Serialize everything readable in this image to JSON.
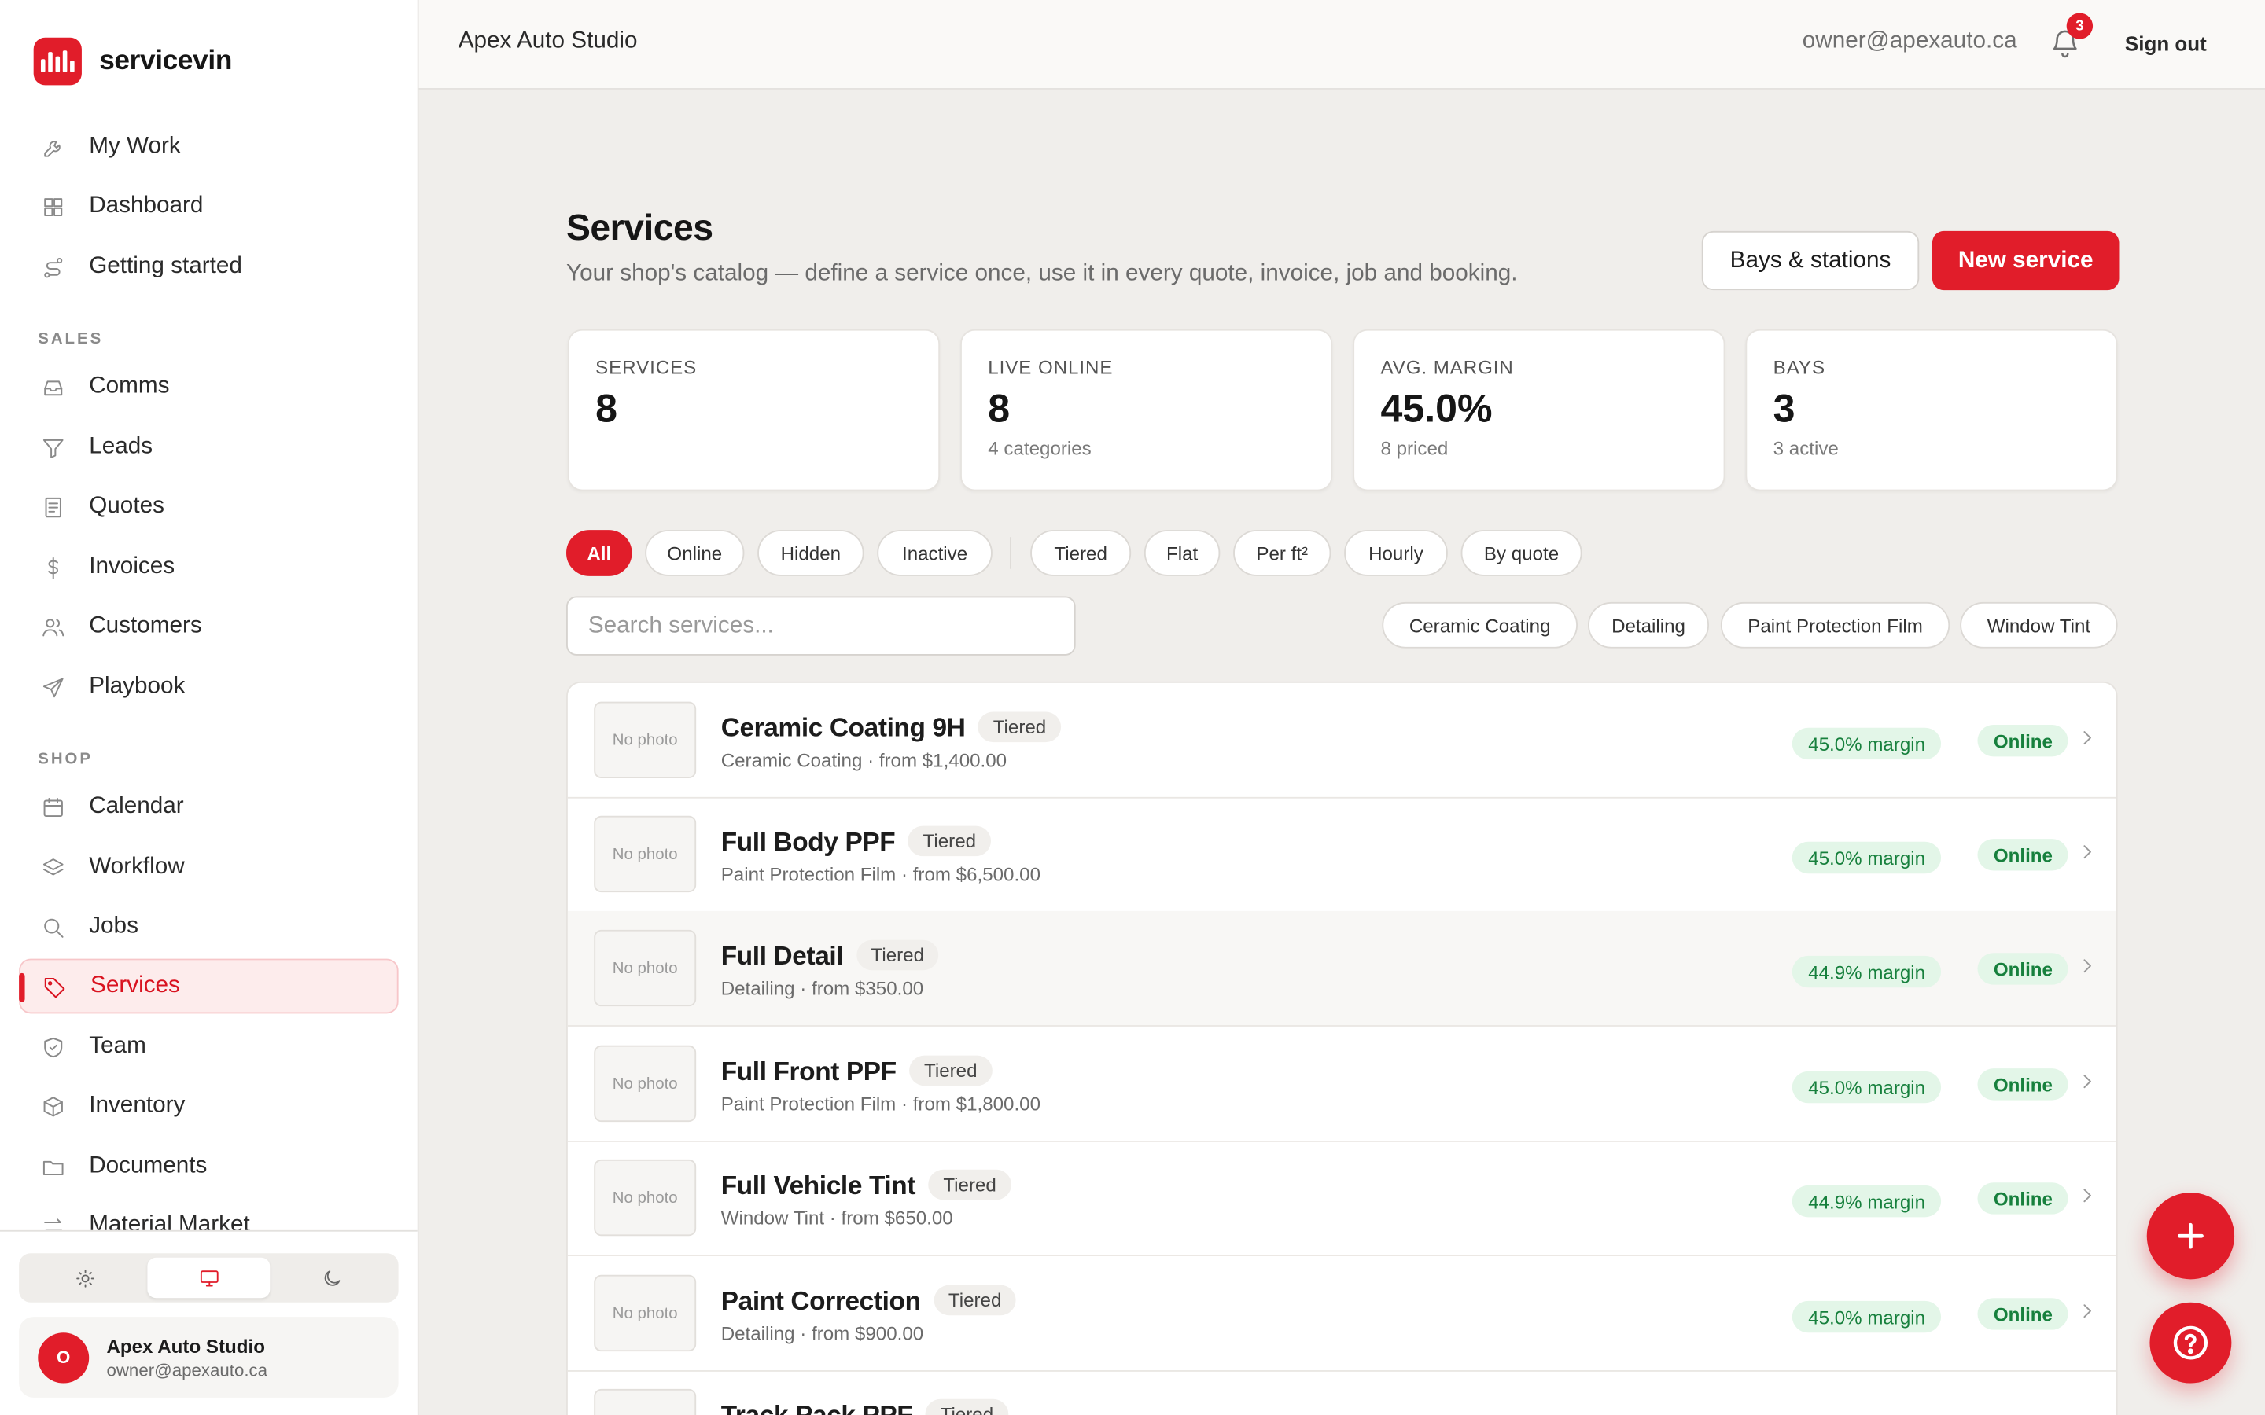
{
  "brand": {
    "name": "servicevin"
  },
  "sidebar": {
    "top_items": [
      {
        "label": "My Work",
        "icon": "wrench-icon"
      },
      {
        "label": "Dashboard",
        "icon": "grid-icon"
      },
      {
        "label": "Getting started",
        "icon": "route-icon"
      }
    ],
    "sales_header": "SALES",
    "sales_items": [
      {
        "label": "Comms",
        "icon": "inbox-icon"
      },
      {
        "label": "Leads",
        "icon": "filter-icon"
      },
      {
        "label": "Quotes",
        "icon": "document-icon"
      },
      {
        "label": "Invoices",
        "icon": "dollar-icon"
      },
      {
        "label": "Customers",
        "icon": "users-icon"
      },
      {
        "label": "Playbook",
        "icon": "send-icon"
      }
    ],
    "shop_header": "SHOP",
    "shop_items": [
      {
        "label": "Calendar",
        "icon": "calendar-icon"
      },
      {
        "label": "Workflow",
        "icon": "layers-icon"
      },
      {
        "label": "Jobs",
        "icon": "search-icon"
      },
      {
        "label": "Services",
        "icon": "tag-icon",
        "active": true
      },
      {
        "label": "Team",
        "icon": "shield-icon"
      },
      {
        "label": "Inventory",
        "icon": "box-icon"
      },
      {
        "label": "Documents",
        "icon": "folder-icon"
      },
      {
        "label": "Material Market",
        "icon": "arrows-icon"
      }
    ],
    "theme": {
      "options": [
        "light-theme",
        "system-theme",
        "dark-theme"
      ],
      "selected": "system-theme"
    },
    "account": {
      "initial": "O",
      "name": "Apex Auto Studio",
      "email": "owner@apexauto.ca"
    }
  },
  "topbar": {
    "shop_name": "Apex Auto Studio",
    "email": "owner@apexauto.ca",
    "notifications": "3",
    "signout": "Sign out"
  },
  "page": {
    "title": "Services",
    "subtitle": "Your shop's catalog — define a service once, use it in every quote, invoice, job and booking.",
    "btn_bays": "Bays & stations",
    "btn_new": "New service"
  },
  "stats": [
    {
      "label": "SERVICES",
      "value": "8",
      "note": ""
    },
    {
      "label": "LIVE ONLINE",
      "value": "8",
      "note": "4 categories"
    },
    {
      "label": "AVG. MARGIN",
      "value": "45.0%",
      "note": "8 priced"
    },
    {
      "label": "BAYS",
      "value": "3",
      "note": "3 active"
    }
  ],
  "filters": {
    "status": [
      "All",
      "Online",
      "Hidden",
      "Inactive"
    ],
    "pricing": [
      "Tiered",
      "Flat",
      "Per ft²",
      "Hourly",
      "By quote"
    ],
    "selected": "All"
  },
  "search": {
    "placeholder": "Search services..."
  },
  "categories": [
    "Ceramic Coating",
    "Detailing",
    "Paint Protection Film",
    "Window Tint"
  ],
  "services": [
    {
      "name": "Ceramic Coating 9H",
      "pricing": "Tiered",
      "meta": "Ceramic Coating · from $1,400.00",
      "margin": "45.0% margin",
      "status": "Online",
      "photo": "No photo"
    },
    {
      "name": "Full Body PPF",
      "pricing": "Tiered",
      "meta": "Paint Protection Film · from $6,500.00",
      "margin": "45.0% margin",
      "status": "Online",
      "photo": "No photo"
    },
    {
      "name": "Full Detail",
      "pricing": "Tiered",
      "meta": "Detailing · from $350.00",
      "margin": "44.9% margin",
      "status": "Online",
      "photo": "No photo"
    },
    {
      "name": "Full Front PPF",
      "pricing": "Tiered",
      "meta": "Paint Protection Film · from $1,800.00",
      "margin": "45.0% margin",
      "status": "Online",
      "photo": "No photo"
    },
    {
      "name": "Full Vehicle Tint",
      "pricing": "Tiered",
      "meta": "Window Tint · from $650.00",
      "margin": "44.9% margin",
      "status": "Online",
      "photo": "No photo"
    },
    {
      "name": "Paint Correction",
      "pricing": "Tiered",
      "meta": "Detailing · from $900.00",
      "margin": "45.0% margin",
      "status": "Online",
      "photo": "No photo"
    },
    {
      "name": "Track Pack PPF",
      "pricing": "Tiered",
      "meta": "",
      "margin": "",
      "status": "",
      "photo": ""
    }
  ]
}
